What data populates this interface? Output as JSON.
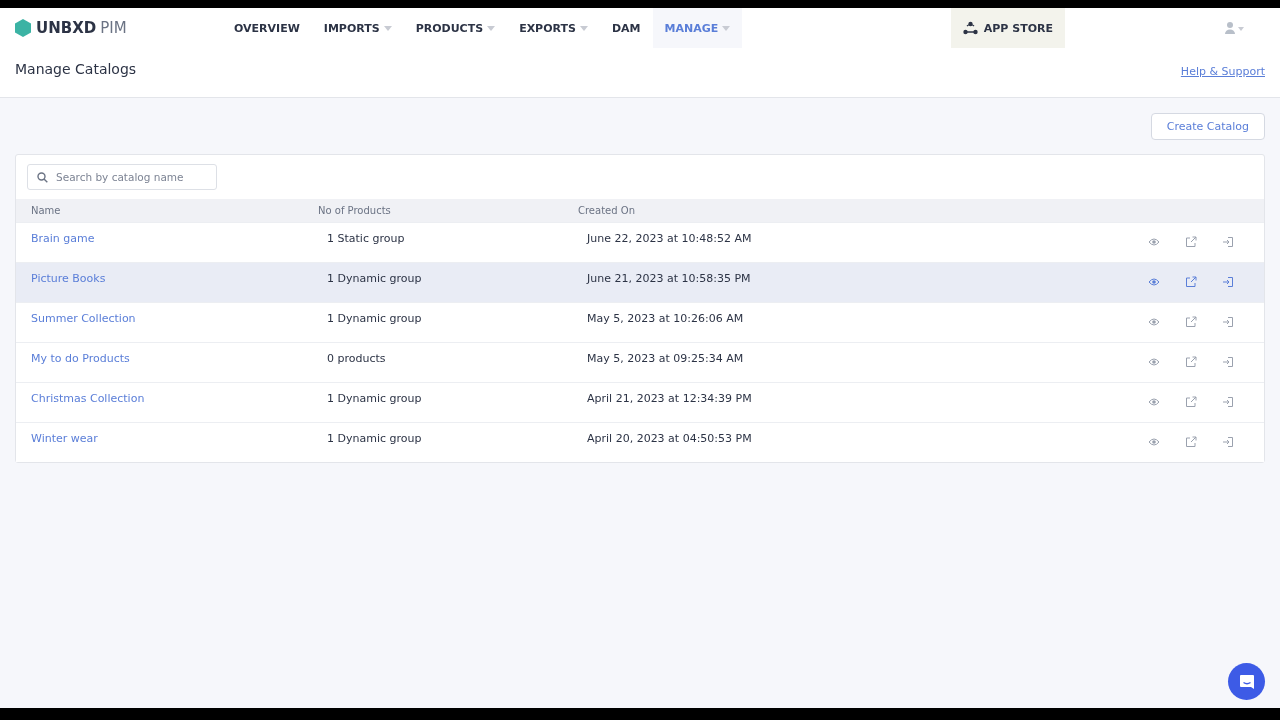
{
  "header": {
    "logo": {
      "brand": "UNBXD",
      "product": "PIM"
    },
    "nav": [
      {
        "label": "OVERVIEW",
        "dropdown": false,
        "selected": false
      },
      {
        "label": "IMPORTS",
        "dropdown": true,
        "selected": false
      },
      {
        "label": "PRODUCTS",
        "dropdown": true,
        "selected": false
      },
      {
        "label": "EXPORTS",
        "dropdown": true,
        "selected": false
      },
      {
        "label": "DAM",
        "dropdown": false,
        "selected": false
      },
      {
        "label": "MANAGE",
        "dropdown": true,
        "selected": true
      }
    ],
    "app_store": "APP STORE"
  },
  "page": {
    "title": "Manage Catalogs",
    "help_link": "Help & Support"
  },
  "create_button": "Create Catalog",
  "search": {
    "placeholder": "Search by catalog name"
  },
  "table": {
    "columns": [
      "Name",
      "No of Products",
      "Created On"
    ],
    "rows": [
      {
        "name": "Brain game",
        "products": "1 Static group",
        "created": "June 22, 2023 at 10:48:52 AM",
        "highlighted": false
      },
      {
        "name": "Picture Books",
        "products": "1 Dynamic group",
        "created": "June 21, 2023 at 10:58:35 PM",
        "highlighted": true
      },
      {
        "name": "Summer Collection",
        "products": "1 Dynamic group",
        "created": "May 5, 2023 at 10:26:06 AM",
        "highlighted": false
      },
      {
        "name": "My to do Products",
        "products": "0 products",
        "created": "May 5, 2023 at 09:25:34 AM",
        "highlighted": false
      },
      {
        "name": "Christmas Collection",
        "products": "1 Dynamic group",
        "created": "April 21, 2023 at 12:34:39 PM",
        "highlighted": false
      },
      {
        "name": "Winter wear",
        "products": "1 Dynamic group",
        "created": "April 20, 2023 at 04:50:53 PM",
        "highlighted": false
      }
    ]
  }
}
